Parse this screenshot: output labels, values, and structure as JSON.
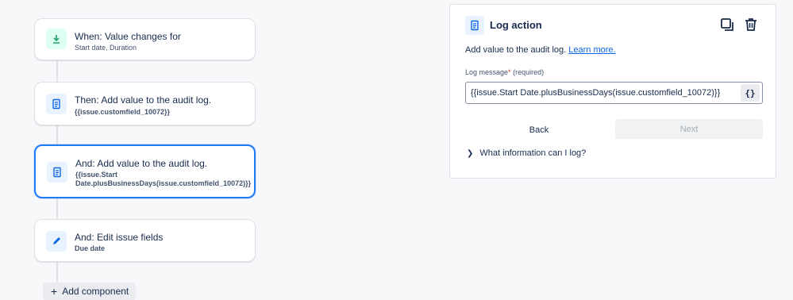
{
  "rule": {
    "cards": [
      {
        "title": "When: Value changes for",
        "sub": "Start date, Duration",
        "icon": "download-icon"
      },
      {
        "title": "Then: Add value to the audit log.",
        "sub": "{{issue.customfield_10072}}",
        "icon": "log-icon"
      },
      {
        "title": "And: Add value to the audit log.",
        "sub": "{{issue.Start Date.plusBusinessDays(issue.customfield_10072)}}",
        "icon": "log-icon"
      },
      {
        "title": "And: Edit issue fields",
        "sub": "Due date",
        "icon": "pencil-icon"
      }
    ],
    "add_component": "Add component"
  },
  "panel": {
    "title": "Log action",
    "description": "Add value to the audit log.",
    "learn_more": "Learn more.",
    "field_label": "Log message",
    "field_required": "(required)",
    "field_value": "{{issue.Start Date.plusBusinessDays(issue.customfield_10072)}}",
    "braces": "{}",
    "back": "Back",
    "next": "Next",
    "expander": "What information can I log?"
  },
  "colors": {
    "accent": "#1d7afc",
    "green_icon": "#22a06b",
    "blue_icon": "#0c66e4"
  }
}
